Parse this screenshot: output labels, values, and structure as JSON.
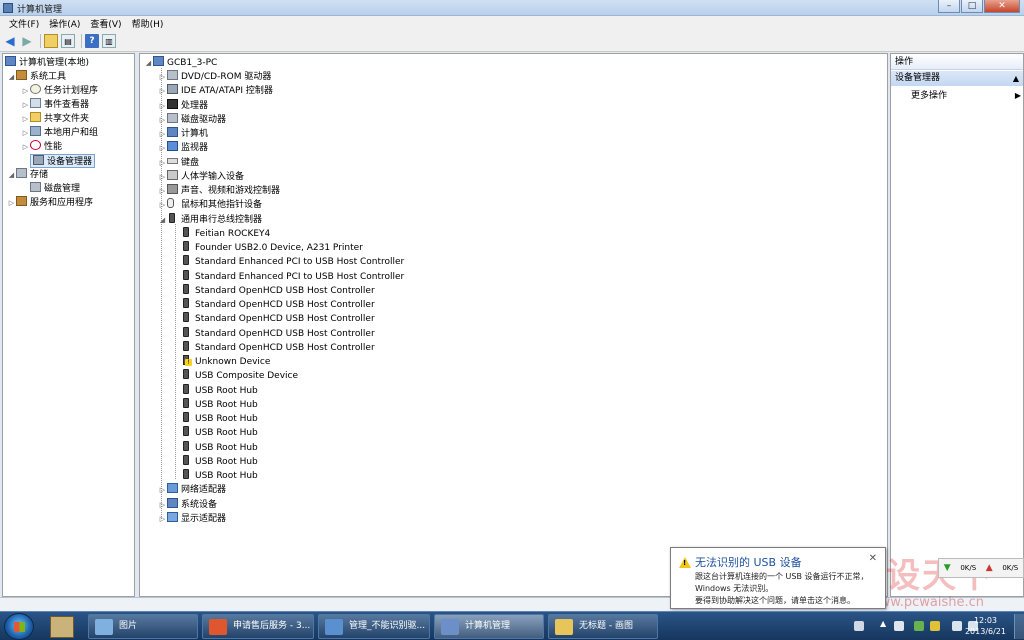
{
  "window": {
    "title": "计算机管理"
  },
  "menu": [
    "文件(F)",
    "操作(A)",
    "查看(V)",
    "帮助(H)"
  ],
  "window_buttons": {
    "minimize": "–",
    "maximize": "□",
    "close": "✕"
  },
  "left_tree": {
    "root": "计算机管理(本地)",
    "system_tools": "系统工具",
    "task_scheduler": "任务计划程序",
    "event_viewer": "事件查看器",
    "shared_folders": "共享文件夹",
    "local_users": "本地用户和组",
    "performance": "性能",
    "device_manager": "设备管理器",
    "storage": "存储",
    "disk_management": "磁盘管理",
    "services": "服务和应用程序"
  },
  "device_tree": {
    "computer": "GCB1_3-PC",
    "categories_top": [
      {
        "label": "DVD/CD-ROM 驱动器",
        "icon": "disk"
      },
      {
        "label": "IDE ATA/ATAPI 控制器",
        "icon": "dev"
      },
      {
        "label": "处理器",
        "icon": "cpu"
      },
      {
        "label": "磁盘驱动器",
        "icon": "disk"
      },
      {
        "label": "计算机",
        "icon": "pc"
      },
      {
        "label": "监视器",
        "icon": "mon"
      },
      {
        "label": "键盘",
        "icon": "kbd"
      },
      {
        "label": "人体学输入设备",
        "icon": "hid"
      },
      {
        "label": "声音、视频和游戏控制器",
        "icon": "snd"
      },
      {
        "label": "鼠标和其他指针设备",
        "icon": "mouse"
      },
      {
        "label": "通用串行总线控制器",
        "icon": "usb"
      }
    ],
    "usb_children": [
      "Feitian ROCKEY4",
      "Founder USB2.0 Device, A231 Printer",
      "Standard Enhanced PCI to USB Host Controller",
      "Standard Enhanced PCI to USB Host Controller",
      "Standard OpenHCD USB Host Controller",
      "Standard OpenHCD USB Host Controller",
      "Standard OpenHCD USB Host Controller",
      "Standard OpenHCD USB Host Controller",
      "Standard OpenHCD USB Host Controller",
      "Unknown Device",
      "USB Composite Device",
      "USB Root Hub",
      "USB Root Hub",
      "USB Root Hub",
      "USB Root Hub",
      "USB Root Hub",
      "USB Root Hub",
      "USB Root Hub"
    ],
    "categories_bottom": [
      {
        "label": "网络适配器",
        "icon": "net"
      },
      {
        "label": "系统设备",
        "icon": "pc"
      },
      {
        "label": "显示适配器",
        "icon": "disp"
      }
    ]
  },
  "actions": {
    "header": "操作",
    "section": "设备管理器",
    "more": "更多操作"
  },
  "balloon": {
    "title": "无法识别的 USB 设备",
    "line1": "跟这台计算机连接的一个 USB 设备运行不正常，",
    "line2": "Windows 无法识别。",
    "line3": "要得到协助解决这个问题，请单击这个消息。"
  },
  "netmeter": {
    "down": "0K/S",
    "up": "0K/S"
  },
  "taskbar": {
    "tasks": [
      {
        "label": "图片",
        "color": "#7fb0e0"
      },
      {
        "label": "申请售后服务 - 3...",
        "color": "#e0572f"
      },
      {
        "label": "管理_不能识别驱...",
        "color": "#5a8fd0"
      },
      {
        "label": "计算机管理",
        "color": "#6d8fc8"
      },
      {
        "label": "无标题 - 画图",
        "color": "#e8c55a"
      }
    ],
    "time": "12:03",
    "date": "2013/6/21"
  },
  "watermark": {
    "text": "外设天下",
    "url": "www.pcwaishe.cn"
  }
}
